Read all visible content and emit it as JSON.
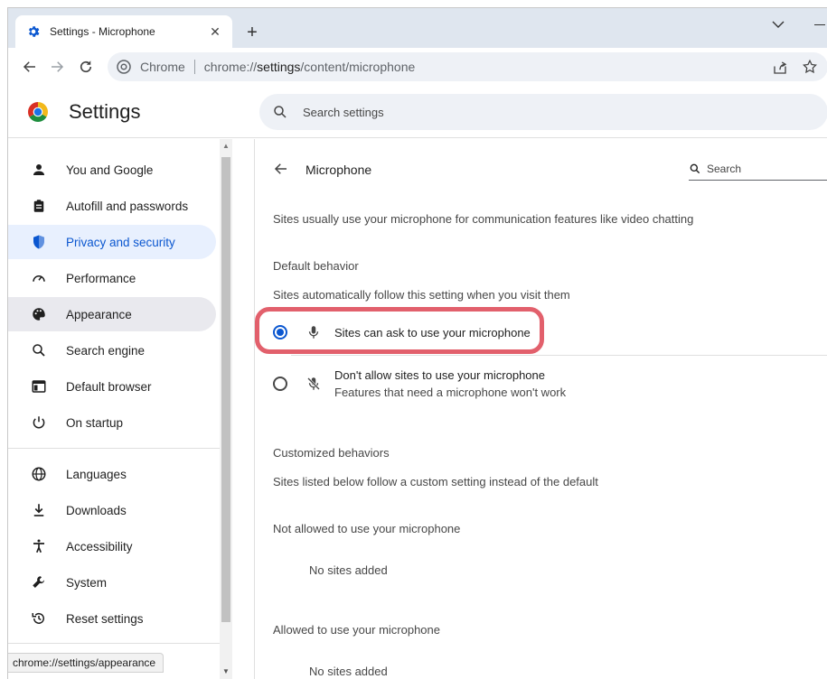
{
  "tab": {
    "title": "Settings - Microphone",
    "close": "✕",
    "new_tab": "+"
  },
  "omnibox": {
    "chip": "Chrome",
    "url_prefix": "chrome://",
    "url_host": "settings",
    "url_path": "/content/microphone"
  },
  "header": {
    "title": "Settings",
    "search_placeholder": "Search settings"
  },
  "sidebar": {
    "items": [
      {
        "label": "You and Google",
        "icon": "person-icon"
      },
      {
        "label": "Autofill and passwords",
        "icon": "clipboard-icon"
      },
      {
        "label": "Privacy and security",
        "icon": "shield-icon",
        "active": true
      },
      {
        "label": "Performance",
        "icon": "speedometer-icon"
      },
      {
        "label": "Appearance",
        "icon": "palette-icon",
        "hover": true
      },
      {
        "label": "Search engine",
        "icon": "search-icon"
      },
      {
        "label": "Default browser",
        "icon": "browser-window-icon"
      },
      {
        "label": "On startup",
        "icon": "power-icon"
      },
      {
        "label": "Languages",
        "icon": "globe-icon"
      },
      {
        "label": "Downloads",
        "icon": "download-icon"
      },
      {
        "label": "Accessibility",
        "icon": "accessibility-icon"
      },
      {
        "label": "System",
        "icon": "wrench-icon"
      },
      {
        "label": "Reset settings",
        "icon": "reset-history-icon"
      }
    ]
  },
  "status_bar": {
    "text": "chrome://settings/appearance"
  },
  "main": {
    "title": "Microphone",
    "search_placeholder": "Search",
    "description": "Sites usually use your microphone for communication features like video chatting",
    "default_behavior": {
      "heading": "Default behavior",
      "subheading": "Sites automatically follow this setting when you visit them",
      "options": [
        {
          "label": "Sites can ask to use your microphone",
          "checked": true
        },
        {
          "label": "Don't allow sites to use your microphone",
          "sublabel": "Features that need a microphone won't work",
          "checked": false
        }
      ]
    },
    "customized": {
      "heading": "Customized behaviors",
      "subheading": "Sites listed below follow a custom setting instead of the default",
      "not_allowed_heading": "Not allowed to use your microphone",
      "not_allowed_empty": "No sites added",
      "allowed_heading": "Allowed to use your microphone",
      "allowed_empty": "No sites added"
    }
  },
  "colors": {
    "accent": "#0b57d0",
    "highlight": "#e2606c",
    "active_nav_bg": "#e8f0fe"
  }
}
